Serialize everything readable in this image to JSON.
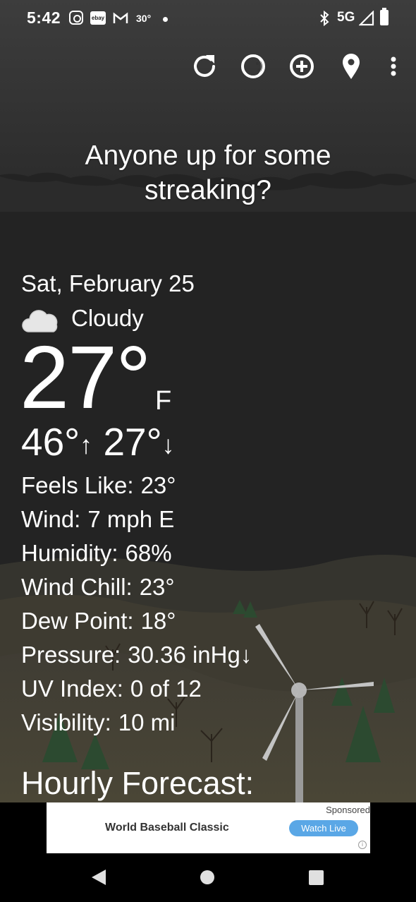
{
  "status_bar": {
    "time": "5:42",
    "ebay": "ebay",
    "temp": "30°",
    "network": "5G"
  },
  "toolbar": {
    "icons": [
      "refresh-icon",
      "moon-icon",
      "add-location-icon",
      "location-pin-icon",
      "more-vert-icon"
    ]
  },
  "headline": "Anyone up for some streaking?",
  "weather": {
    "date": "Sat, February 25",
    "condition": "Cloudy",
    "temperature": "27°",
    "unit": "F",
    "high": "46°",
    "low": "27°",
    "high_arrow": "↑",
    "low_arrow": "↓"
  },
  "details": [
    {
      "label": "Feels Like:",
      "value": "23°"
    },
    {
      "label": "Wind:",
      "value": "7 mph E"
    },
    {
      "label": "Humidity:",
      "value": "68%"
    },
    {
      "label": "Wind Chill:",
      "value": "23°"
    },
    {
      "label": "Dew Point:",
      "value": "18°"
    },
    {
      "label": "Pressure:",
      "value": "30.36 inHg↓"
    },
    {
      "label": "UV Index:",
      "value": "0 of 12"
    },
    {
      "label": "Visibility:",
      "value": "10 mi"
    }
  ],
  "hourly_heading": "Hourly Forecast:",
  "ad": {
    "sponsored": "Sponsored",
    "title": "World Baseball Classic",
    "button": "Watch Live"
  },
  "colors": {
    "background": "#232323",
    "ad_button": "#5aa7e6"
  }
}
